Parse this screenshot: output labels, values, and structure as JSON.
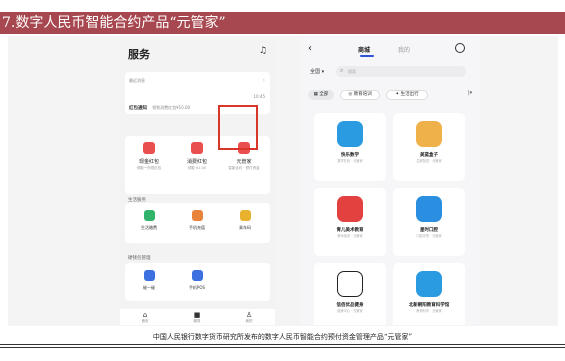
{
  "header": {
    "title": "7.数字人民币智能合约产品“元管家”"
  },
  "left_phone": {
    "title": "服务",
    "message_section": {
      "label": "最近消息",
      "item_title": "红包通知",
      "item_text": "领到消费红包¥10.00",
      "time": "10:45"
    },
    "red_items": [
      {
        "label": "现金红包",
        "sub": "领取一份现红包",
        "color": "#e94f4f"
      },
      {
        "label": "消费红包",
        "sub": "领取 ¥1.00",
        "color": "#e94f4f"
      },
      {
        "label": "元管家",
        "sub": "智能合约 · 预付资金",
        "color": "#e94f4f"
      }
    ],
    "life_section": {
      "label": "生活服务",
      "items": [
        {
          "label": "生活缴费",
          "color": "#31b36b"
        },
        {
          "label": "手机充值",
          "color": "#e7833a"
        },
        {
          "label": "乘车码",
          "color": "#e8b22e"
        }
      ]
    },
    "good_section": {
      "label": "硬钱包管理",
      "items": [
        {
          "label": "碰一碰",
          "color": "#3c6fe0"
        },
        {
          "label": "手机POS",
          "color": "#3c6fe0"
        }
      ]
    },
    "tabs": [
      {
        "label": "首页",
        "icon": "home-icon",
        "glyph": "⌂"
      },
      {
        "label": "服务",
        "icon": "grid-icon",
        "glyph": "■"
      },
      {
        "label": "我的",
        "icon": "user-icon",
        "glyph": "♙"
      }
    ]
  },
  "right_phone": {
    "back": "‹",
    "tabs": {
      "mall": "商城",
      "mine": "我的"
    },
    "country": "全国 ▾",
    "search_placeholder": "搜索",
    "chips": [
      "全部",
      "教育培训",
      "生活出行"
    ],
    "chip_more": "|▾",
    "apps": [
      {
        "name": "快乐数学",
        "desc": "数学在线 · 元管家",
        "color": "#2a9be0"
      },
      {
        "name": "美篮盒子",
        "desc": "生鲜配送 · 元管家",
        "color": "#efb24a"
      },
      {
        "name": "青儿美术教育",
        "desc": "美术培训 · 元管家",
        "color": "#e2413f"
      },
      {
        "name": "星时口腔",
        "desc": "口腔诊所 · 元管家",
        "color": "#2a8fe0"
      },
      {
        "name": "信佰优品健身",
        "desc": "健身中心 · 元管家",
        "color": "#222222"
      },
      {
        "name": "北新朝阳教育科学馆",
        "desc": "教育科学 · 元管家",
        "color": "#2a9be0"
      }
    ]
  },
  "caption": "中国人民银行数字货币研究所发布的数字人民币智能合约预付资金管理产品“元管家”"
}
